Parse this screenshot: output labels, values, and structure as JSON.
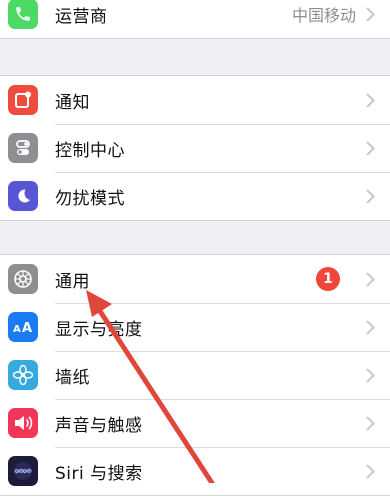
{
  "carrier": {
    "label": "运营商",
    "value": "中国移动",
    "icon": "phone-icon",
    "color": "#4cd964"
  },
  "group2": [
    {
      "label": "通知",
      "icon": "notification-icon",
      "color": "#f04c3e"
    },
    {
      "label": "控制中心",
      "icon": "control-center-icon",
      "color": "#8e8e93"
    },
    {
      "label": "勿扰模式",
      "icon": "moon-icon",
      "color": "#5856d6"
    }
  ],
  "group3": [
    {
      "label": "通用",
      "icon": "gear-icon",
      "color": "#8e8e93",
      "badge": "1"
    },
    {
      "label": "显示与亮度",
      "icon": "text-size-icon",
      "color": "#1a7cf2"
    },
    {
      "label": "墙纸",
      "icon": "wallpaper-flower-icon",
      "color": "#35aadc"
    },
    {
      "label": "声音与触感",
      "icon": "speaker-icon",
      "color": "#f2365a"
    },
    {
      "label": "Siri 与搜索",
      "icon": "siri-icon",
      "color": "#1c1c3a"
    }
  ],
  "annotation_color": "#e0463a"
}
